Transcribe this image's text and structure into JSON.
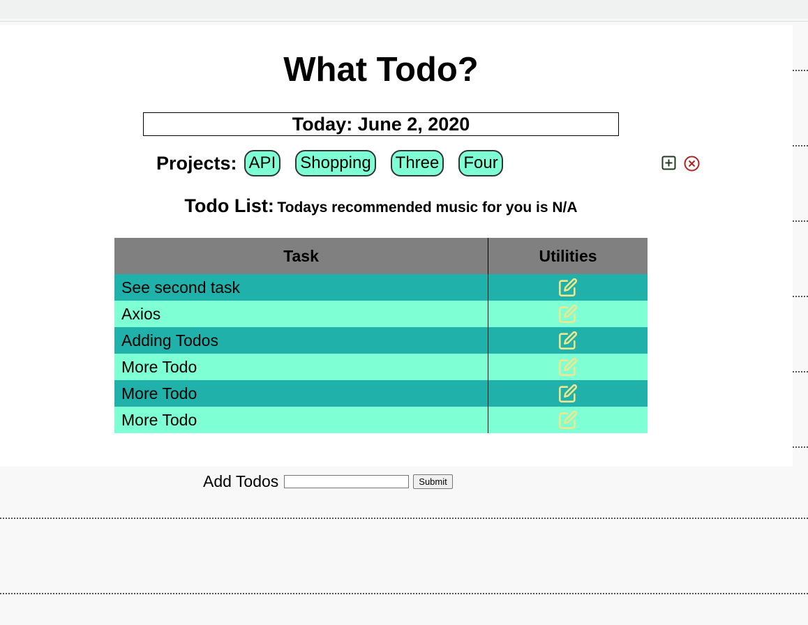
{
  "app": {
    "title": "What Todo?",
    "today": "Today: June 2, 2020"
  },
  "projects": {
    "label": "Projects:",
    "items": [
      "API",
      "Shopping",
      "Three",
      "Four"
    ],
    "add_icon": "plus-square-icon",
    "delete_icon": "x-circle-icon"
  },
  "todo": {
    "heading": "Todo List:",
    "music": "Todays recommended music for you is N/A"
  },
  "table": {
    "headers": [
      "Task",
      "Utilities"
    ],
    "rows": [
      {
        "task": "See second task",
        "icon": "edit-icon"
      },
      {
        "task": "Axios",
        "icon": "edit-icon"
      },
      {
        "task": "Adding Todos",
        "icon": "edit-icon"
      },
      {
        "task": "More Todo",
        "icon": "edit-icon"
      },
      {
        "task": "More Todo",
        "icon": "edit-icon"
      },
      {
        "task": "More Todo",
        "icon": "edit-icon"
      }
    ]
  },
  "add_form": {
    "label": "Add Todos",
    "input_value": "",
    "input_placeholder": "",
    "submit_label": "Submit"
  },
  "colors": {
    "row_dark": "#20b2aa",
    "row_light": "#7fffd4",
    "header_bg": "#7f807f",
    "project_bg": "#7fffd4",
    "edit_icon": "#f0e68c",
    "add_icon": "#1e3d1e",
    "delete_icon": "#b22222"
  }
}
